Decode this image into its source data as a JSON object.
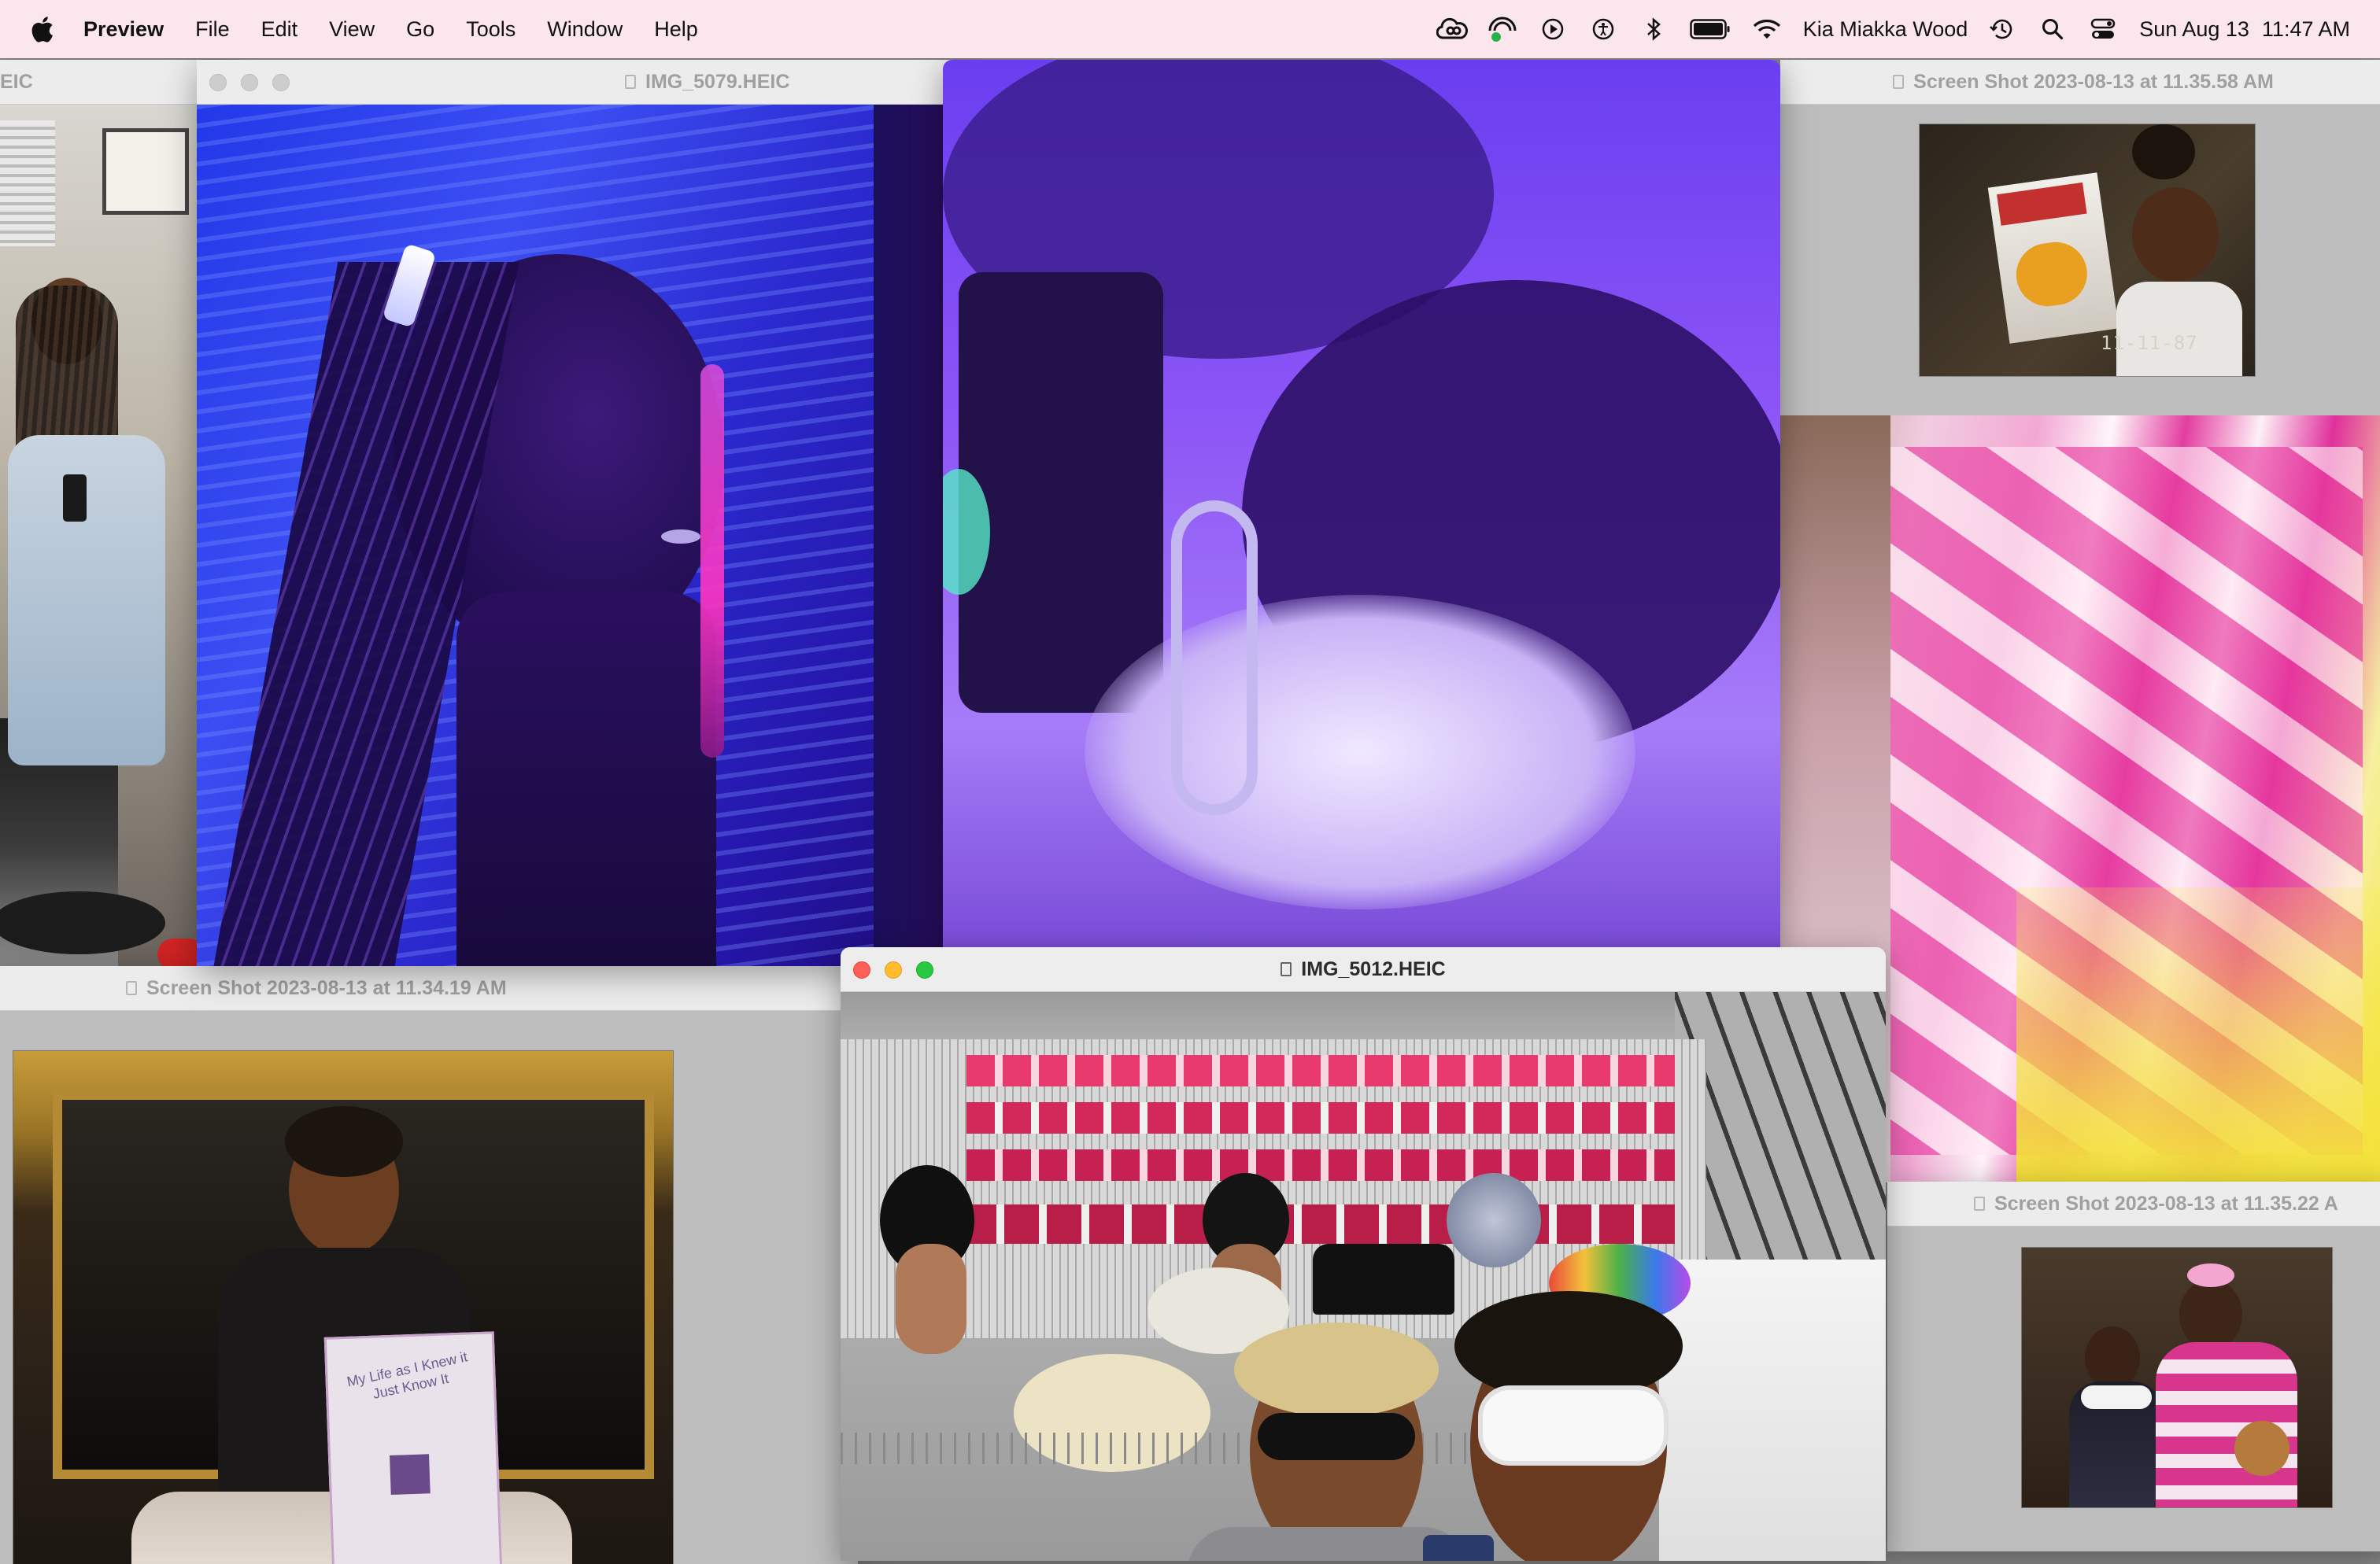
{
  "menubar": {
    "app_name": "Preview",
    "menus": [
      "File",
      "Edit",
      "View",
      "Go",
      "Tools",
      "Window",
      "Help"
    ],
    "user_name": "Kia Miakka Wood",
    "date": "Sun Aug 13",
    "time": "11:47 AM"
  },
  "windows": {
    "far_left": {
      "title": "EIC"
    },
    "img_5079": {
      "title": "IMG_5079.HEIC"
    },
    "ss_113558": {
      "title": "Screen Shot 2023-08-13 at 11.35.58 AM",
      "video_stamp": "11-11-87"
    },
    "ss_113419": {
      "title": "Screen Shot 2023-08-13 at 11.34.19 AM",
      "book_text": "My Life as I Knew it Just Know It"
    },
    "img_5012": {
      "title": "IMG_5012.HEIC"
    },
    "ss_113522": {
      "title": "Screen Shot 2023-08-13 at 11.35.22 A"
    }
  },
  "colors": {
    "menubar_bg": "#fbe6ee",
    "desktop_gray": "#8a8a8a",
    "active_red": "#fe5f57",
    "active_yellow": "#febc2e",
    "active_green": "#28c840"
  }
}
